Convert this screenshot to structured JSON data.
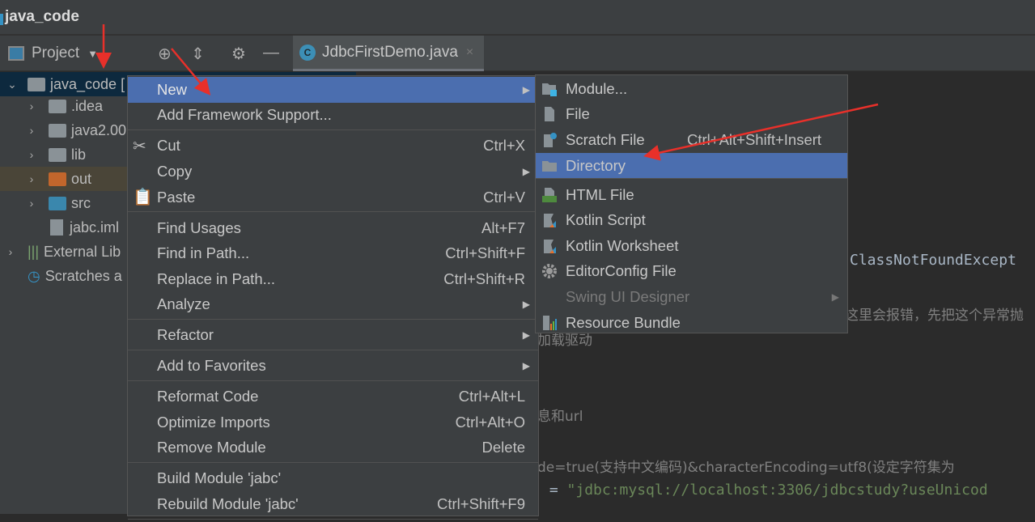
{
  "window": {
    "title": "java_code"
  },
  "toolbar": {
    "project_label": "Project",
    "icons": [
      "target-icon",
      "collapse-icon",
      "gear-icon",
      "minimize-icon"
    ]
  },
  "tab": {
    "label": "JdbcFirstDemo.java",
    "close": "×"
  },
  "tree": [
    {
      "label": "java_code [",
      "expanded": true
    },
    {
      "label": ".idea"
    },
    {
      "label": "java2.00"
    },
    {
      "label": "lib"
    },
    {
      "label": "out"
    },
    {
      "label": "src"
    },
    {
      "label": "jabc.iml"
    },
    {
      "label": "External Lib"
    },
    {
      "label": "Scratches a"
    }
  ],
  "context_menu": [
    {
      "label": "New",
      "submenu": true,
      "selected": true
    },
    {
      "label": "Add Framework Support..."
    },
    {
      "sep": true
    },
    {
      "label": "Cut",
      "shortcut": "Ctrl+X",
      "icon": "scissors-icon"
    },
    {
      "label": "Copy",
      "submenu": true
    },
    {
      "label": "Paste",
      "shortcut": "Ctrl+V",
      "icon": "clipboard-icon"
    },
    {
      "sep": true
    },
    {
      "label": "Find Usages",
      "shortcut": "Alt+F7"
    },
    {
      "label": "Find in Path...",
      "shortcut": "Ctrl+Shift+F"
    },
    {
      "label": "Replace in Path...",
      "shortcut": "Ctrl+Shift+R"
    },
    {
      "label": "Analyze",
      "submenu": true
    },
    {
      "sep": true
    },
    {
      "label": "Refactor",
      "submenu": true
    },
    {
      "sep": true
    },
    {
      "label": "Add to Favorites",
      "submenu": true
    },
    {
      "sep": true
    },
    {
      "label": "Reformat Code",
      "shortcut": "Ctrl+Alt+L"
    },
    {
      "label": "Optimize Imports",
      "shortcut": "Ctrl+Alt+O"
    },
    {
      "label": "Remove Module",
      "shortcut": "Delete"
    },
    {
      "sep": true
    },
    {
      "label": "Build Module 'jabc'"
    },
    {
      "label": "Rebuild Module 'jabc'",
      "shortcut": "Ctrl+Shift+F9"
    },
    {
      "sep": true
    }
  ],
  "new_submenu": [
    {
      "label": "Module...",
      "icon": "module-icon"
    },
    {
      "label": "File",
      "icon": "file-icon"
    },
    {
      "label": "Scratch File",
      "shortcut": "Ctrl+Alt+Shift+Insert",
      "icon": "scratch-file-icon"
    },
    {
      "label": "Directory",
      "icon": "folder-icon",
      "selected": true
    },
    {
      "sep": true
    },
    {
      "label": "HTML File",
      "icon": "html-file-icon"
    },
    {
      "label": "Kotlin Script",
      "icon": "kotlin-icon"
    },
    {
      "label": "Kotlin Worksheet",
      "icon": "kotlin-icon"
    },
    {
      "label": "EditorConfig File",
      "icon": "gear-icon"
    },
    {
      "label": "Swing UI Designer",
      "disabled": true,
      "submenu": true
    },
    {
      "label": "Resource Bundle",
      "icon": "resource-bundle-icon"
    }
  ],
  "editor": {
    "line1": "ClassNotFoundExcept",
    "line2": "这里会报错，先把这个异常抛",
    "line3": "加载驱动",
    "line4": "息和url",
    "line5": "de=true(支持中文编码)&characterEncoding=utf8(设定字符集为",
    "line6_op": " = ",
    "line6_str": "\"jdbc:mysql://localhost:3306/jdbcstudy?useUnicod"
  },
  "colors": {
    "selection": "#4b6eaf",
    "annotation_arrow": "#e8302a"
  }
}
